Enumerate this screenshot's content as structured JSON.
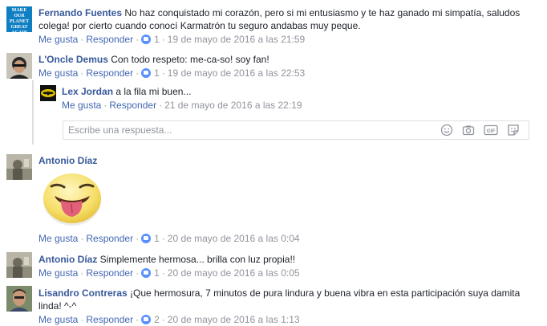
{
  "labels": {
    "like": "Me gusta",
    "reply": "Responder",
    "sep": "·"
  },
  "comments": [
    {
      "author": "Fernando Fuentes",
      "text": "No haz conquistado mi corazón, pero si mi entusiasmo y te haz ganado mi simpatía, saludos colega! por cierto cuando conocí Karmatrón tu seguro andabas muy peque.",
      "likes": "1",
      "date": "19 de mayo de 2016 a las 21:59",
      "avatar_text": "MAKE OUR PLANET GREAT AGAIN"
    },
    {
      "author": "L'Oncle Demus",
      "text": "Con todo respeto: me-ca-so! soy fan!",
      "likes": "1",
      "date": "19 de mayo de 2016 a las 22:53"
    },
    {
      "author": "Lex Jordan",
      "text": "a la fila mi buen...",
      "likes": "",
      "date": "21 de mayo de 2016 a las 22:19"
    },
    {
      "author": "Antonio Díaz",
      "text": "",
      "likes": "1",
      "date": "20 de mayo de 2016 a las 0:04"
    },
    {
      "author": "Antonio Díaz",
      "text": "Simplemente hermosa... brilla con luz propia!!",
      "likes": "1",
      "date": "20 de mayo de 2016 a las 0:05"
    },
    {
      "author": "Lisandro Contreras",
      "text": "¡Que hermosura, 7 minutos de pura lindura y buena vibra en esta participación suya damita linda! ^-^",
      "likes": "2",
      "date": "20 de mayo de 2016 a las 1:13"
    }
  ],
  "reply_box": {
    "placeholder": "Escribe una respuesta..."
  },
  "icons": {
    "like": "like-thumb-icon",
    "emoji": "smiley-icon",
    "camera": "camera-icon",
    "gif": "gif-icon",
    "sticker": "sticker-icon"
  }
}
